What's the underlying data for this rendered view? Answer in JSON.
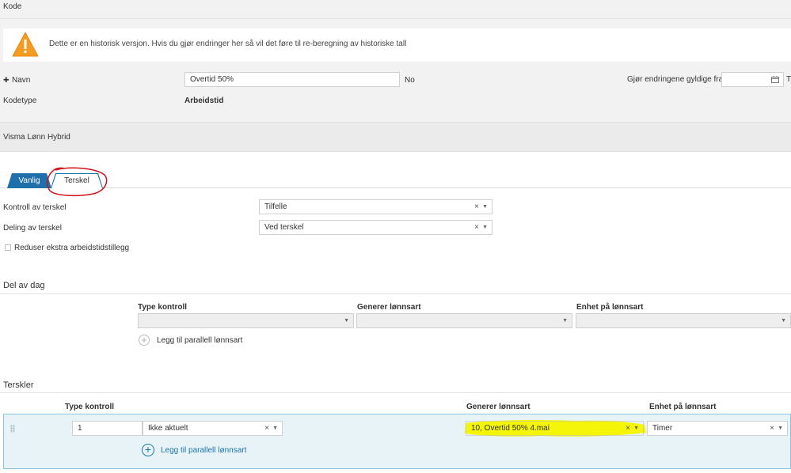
{
  "header": {
    "title": "Kode"
  },
  "warning": {
    "icon": "warning-triangle-icon",
    "text": "Dette er en historisk versjon. Hvis du gjør endringer her så vil det føre til re-beregning av historiske tall"
  },
  "fields": {
    "navn_label": "Navn",
    "navn_value": "Overtid 50%",
    "navn_lang": "No",
    "valid_from_label": "Gjør endringene gyldige fra",
    "valid_from_value": "",
    "valid_from_suffix": "Ti",
    "kodetype_label": "Kodetype",
    "kodetype_value": "Arbeidstid"
  },
  "system": {
    "name": "Visma Lønn Hybrid"
  },
  "tabs": [
    {
      "label": "Vanlig",
      "active": false
    },
    {
      "label": "Terskel",
      "active": true
    }
  ],
  "terskel": {
    "kontroll_label": "Kontroll av terskel",
    "kontroll_value": "Tilfelle",
    "deling_label": "Deling av terskel",
    "deling_value": "Ved terskel",
    "reduser_label": "Reduser ekstra arbeidstidstillegg",
    "reduser_checked": false
  },
  "del_av_dag": {
    "title": "Del av dag",
    "columns": [
      "Type kontroll",
      "Generer lønnsart",
      "Enhet på lønnsart"
    ],
    "add_label": "Legg til parallell lønnsart"
  },
  "terskler": {
    "title": "Terskler",
    "columns": [
      "Type kontroll",
      "Generer lønnsart",
      "Enhet på lønnsart"
    ],
    "row": {
      "number": "1",
      "type_kontroll": "Ikke aktuelt",
      "generer_lonnsart": "10, Overtid 50% 4.mai",
      "enhet": "Timer"
    },
    "add_label": "Legg til parallell lønnsart"
  },
  "colors": {
    "accent_blue": "#1a73a8",
    "tab_active_bg": "#1f6fab",
    "highlight_yellow": "#f5f50a",
    "annotation_red": "#d0101a"
  },
  "glyphs": {
    "clear": "×",
    "caret": "▼",
    "pin": "✚"
  }
}
